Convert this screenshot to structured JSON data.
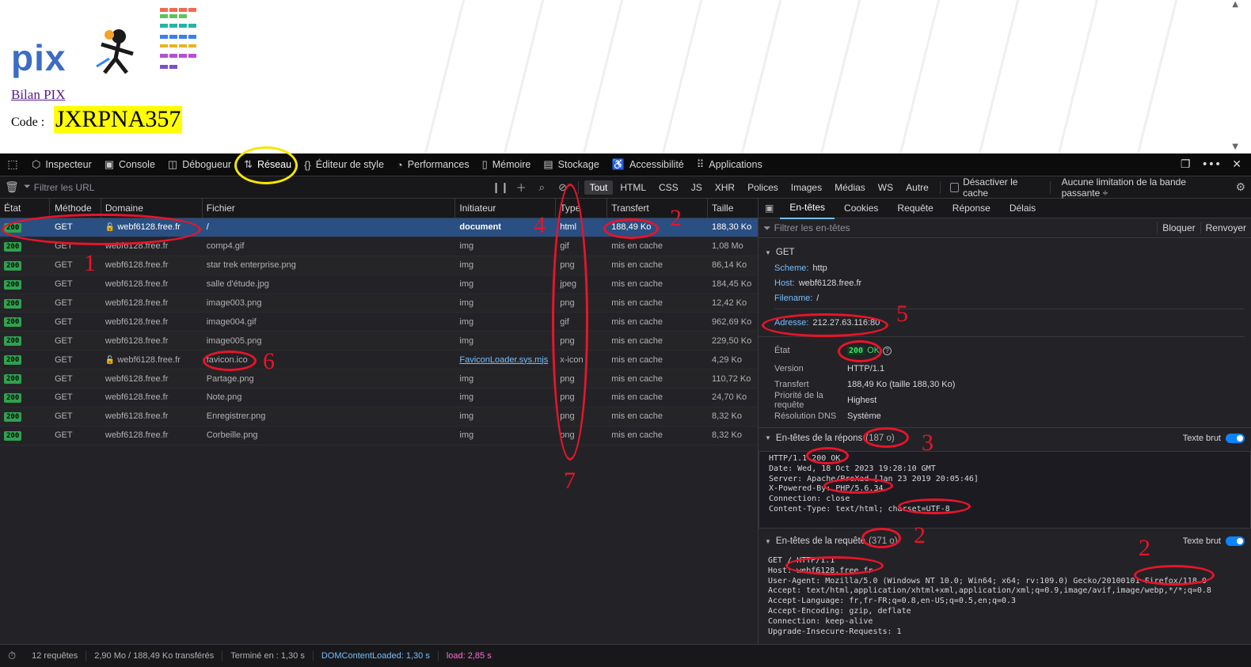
{
  "webpage": {
    "logo_text": "pix",
    "link_text": "Bilan PIX",
    "code_label": "Code :",
    "code_value": "JXRPNA357"
  },
  "toolbar": {
    "tabs": [
      "Inspecteur",
      "Console",
      "Débogueur",
      "Réseau",
      "Éditeur de style",
      "Performances",
      "Mémoire",
      "Stockage",
      "Accessibilité",
      "Applications"
    ],
    "active_tab": "Réseau"
  },
  "filterbar": {
    "url_placeholder": "Filtrer les URL",
    "type_filters": [
      "Tout",
      "HTML",
      "CSS",
      "JS",
      "XHR",
      "Polices",
      "Images",
      "Médias",
      "WS",
      "Autre"
    ],
    "active_filter": "Tout",
    "cache_label": "Désactiver le cache",
    "throttle_label": "Aucune limitation de la bande passante ÷"
  },
  "columns": [
    "État",
    "Méthode",
    "Domaine",
    "Fichier",
    "Initiateur",
    "Type",
    "Transfert",
    "Taille"
  ],
  "requests": [
    {
      "status": "200",
      "method": "GET",
      "domain": "webf6128.free.fr",
      "file": "/",
      "initiator": "document",
      "type": "html",
      "transfer": "188,49 Ko",
      "size": "188,30 Ko"
    },
    {
      "status": "200",
      "method": "GET",
      "domain": "webf6128.free.fr",
      "file": "comp4.gif",
      "initiator": "img",
      "type": "gif",
      "transfer": "mis en cache",
      "size": "1,08 Mo"
    },
    {
      "status": "200",
      "method": "GET",
      "domain": "webf6128.free.fr",
      "file": "star trek enterprise.png",
      "initiator": "img",
      "type": "png",
      "transfer": "mis en cache",
      "size": "86,14 Ko"
    },
    {
      "status": "200",
      "method": "GET",
      "domain": "webf6128.free.fr",
      "file": "salle d'étude.jpg",
      "initiator": "img",
      "type": "jpeg",
      "transfer": "mis en cache",
      "size": "184,45 Ko"
    },
    {
      "status": "200",
      "method": "GET",
      "domain": "webf6128.free.fr",
      "file": "image003.png",
      "initiator": "img",
      "type": "png",
      "transfer": "mis en cache",
      "size": "12,42 Ko"
    },
    {
      "status": "200",
      "method": "GET",
      "domain": "webf6128.free.fr",
      "file": "image004.gif",
      "initiator": "img",
      "type": "gif",
      "transfer": "mis en cache",
      "size": "962,69 Ko"
    },
    {
      "status": "200",
      "method": "GET",
      "domain": "webf6128.free.fr",
      "file": "image005.png",
      "initiator": "img",
      "type": "png",
      "transfer": "mis en cache",
      "size": "229,50 Ko"
    },
    {
      "status": "200",
      "method": "GET",
      "domain": "webf6128.free.fr",
      "file": "favicon.ico",
      "initiator": "FaviconLoader.sys.mjs",
      "type": "x-icon",
      "transfer": "mis en cache",
      "size": "4,29 Ko"
    },
    {
      "status": "200",
      "method": "GET",
      "domain": "webf6128.free.fr",
      "file": "Partage.png",
      "initiator": "img",
      "type": "png",
      "transfer": "mis en cache",
      "size": "110,72 Ko"
    },
    {
      "status": "200",
      "method": "GET",
      "domain": "webf6128.free.fr",
      "file": "Note.png",
      "initiator": "img",
      "type": "png",
      "transfer": "mis en cache",
      "size": "24,70 Ko"
    },
    {
      "status": "200",
      "method": "GET",
      "domain": "webf6128.free.fr",
      "file": "Enregistrer.png",
      "initiator": "img",
      "type": "png",
      "transfer": "mis en cache",
      "size": "8,32 Ko"
    },
    {
      "status": "200",
      "method": "GET",
      "domain": "webf6128.free.fr",
      "file": "Corbeille.png",
      "initiator": "img",
      "type": "png",
      "transfer": "mis en cache",
      "size": "8,32 Ko"
    }
  ],
  "statusbar": {
    "requests": "12 requêtes",
    "transferred": "2,90 Mo / 188,49 Ko transférés",
    "finished": "Terminé en : 1,30 s",
    "domcontent": "DOMContentLoaded: 1,30 s",
    "load": "load: 2,85 s"
  },
  "details": {
    "tabs": [
      "En-têtes",
      "Cookies",
      "Requête",
      "Réponse",
      "Délais"
    ],
    "active_tab": "En-têtes",
    "filter_placeholder": "Filtrer les en-têtes",
    "block_label": "Bloquer",
    "resend_label": "Renvoyer",
    "get_label": "GET",
    "scheme_k": "Scheme:",
    "scheme_v": "http",
    "host_k": "Host:",
    "host_v": "webf6128.free.fr",
    "filename_k": "Filename:",
    "filename_v": "/",
    "address_k": "Adresse:",
    "address_v": "212.27.63.116:80",
    "state_k": "État",
    "state_code": "200",
    "state_text": "OK",
    "version_k": "Version",
    "version_v": "HTTP/1.1",
    "transfer_k": "Transfert",
    "transfer_v": "188,49 Ko (taille 188,30 Ko)",
    "priority_k": "Priorité de la requête",
    "priority_v": "Highest",
    "dns_k": "Résolution DNS",
    "dns_v": "Système",
    "resp_title": "En-têtes de la répons",
    "resp_size": "(187 o)",
    "req_title": "En-têtes de la requête",
    "req_size": "(371 o)",
    "raw_label": "Texte brut",
    "resp_raw": "HTTP/1.1 200 OK\nDate: Wed, 18 Oct 2023 19:28:10 GMT\nServer: Apache/ProXad [Jan 23 2019 20:05:46]\nX-Powered-By: PHP/5.6.34\nConnection: close\nContent-Type: text/html; charset=UTF-8",
    "req_raw": "GET / HTTP/1.1\nHost: webf6128.free.fr\nUser-Agent: Mozilla/5.0 (Windows NT 10.0; Win64; x64; rv:109.0) Gecko/20100101 Firefox/118.0\nAccept: text/html,application/xhtml+xml,application/xml;q=0.9,image/avif,image/webp,*/*;q=0.8\nAccept-Language: fr,fr-FR;q=0.8,en-US;q=0.5,en;q=0.3\nAccept-Encoding: gzip, deflate\nConnection: keep-alive\nUpgrade-Insecure-Requests: 1"
  },
  "annotations": [
    "1",
    "2",
    "2",
    "2",
    "3",
    "4",
    "5",
    "6",
    "7"
  ],
  "colors": {
    "annotation": "#e8142a",
    "highlight": "#f5e600",
    "selected_row": "#2a4f82"
  }
}
